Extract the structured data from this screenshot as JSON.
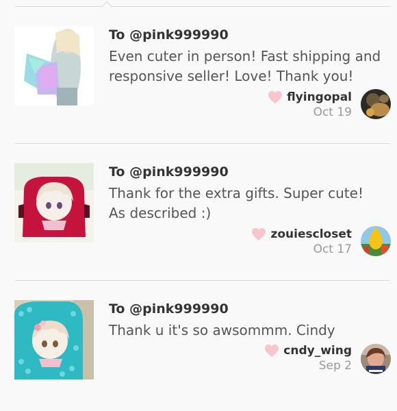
{
  "reviews": [
    {
      "to": "To @pink999990",
      "text": "Even cuter in person! Fast shipping and responsive seller! Love! Thank you!",
      "username": "flyingopal",
      "date": "Oct 19",
      "heart_color": "#f7c6cc"
    },
    {
      "to": "To @pink999990",
      "text": "Thank for the extra gifts. Super cute! As described :)",
      "username": "zouiescloset",
      "date": "Oct 17",
      "heart_color": "#f7c6cc"
    },
    {
      "to": "To @pink999990",
      "text": "Thank u it's so awsommm. Cindy",
      "username": "cndy_wing",
      "date": "Sep 2",
      "heart_color": "#f7c6cc"
    }
  ]
}
